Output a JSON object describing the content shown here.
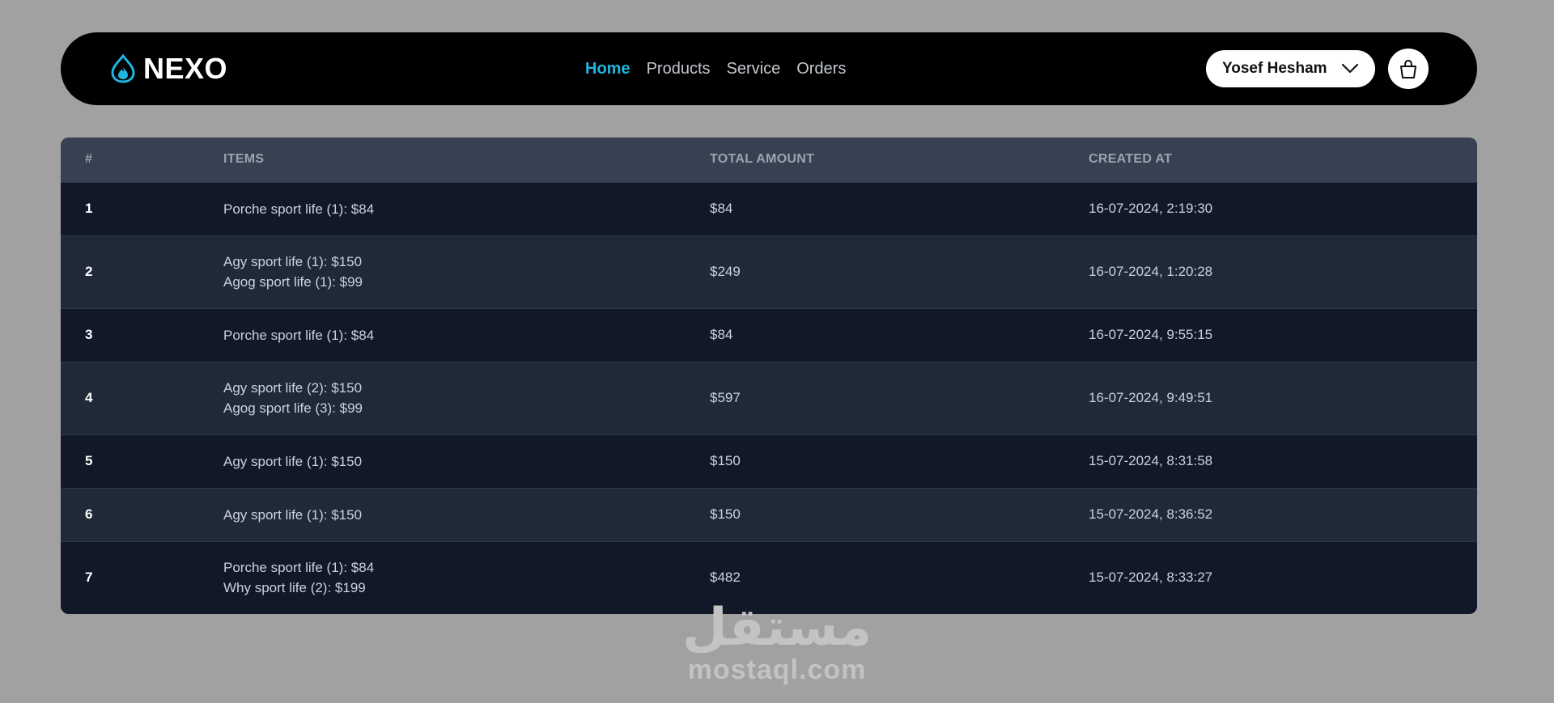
{
  "brand": {
    "name": "NEXO",
    "accent": "#1fb6e0"
  },
  "nav": {
    "links": [
      {
        "label": "Home",
        "active": true
      },
      {
        "label": "Products",
        "active": false
      },
      {
        "label": "Service",
        "active": false
      },
      {
        "label": "Orders",
        "active": false
      }
    ]
  },
  "user": {
    "name": "Yosef Hesham",
    "menu_icon": "chevron-down-icon"
  },
  "cart": {
    "icon": "shopping-bag-icon"
  },
  "orders_table": {
    "headers": [
      "#",
      "ITEMS",
      "TOTAL AMOUNT",
      "CREATED AT"
    ],
    "rows": [
      {
        "id": "1",
        "items": [
          "Porche sport life (1): $84"
        ],
        "total": "$84",
        "created": "16-07-2024, 2:19:30"
      },
      {
        "id": "2",
        "items": [
          "Agy sport life (1): $150",
          "Agog sport life (1): $99"
        ],
        "total": "$249",
        "created": "16-07-2024, 1:20:28"
      },
      {
        "id": "3",
        "items": [
          "Porche sport life (1): $84"
        ],
        "total": "$84",
        "created": "16-07-2024, 9:55:15"
      },
      {
        "id": "4",
        "items": [
          "Agy sport life (2): $150",
          "Agog sport life (3): $99"
        ],
        "total": "$597",
        "created": "16-07-2024, 9:49:51"
      },
      {
        "id": "5",
        "items": [
          "Agy sport life (1): $150"
        ],
        "total": "$150",
        "created": "15-07-2024, 8:31:58"
      },
      {
        "id": "6",
        "items": [
          "Agy sport life (1): $150"
        ],
        "total": "$150",
        "created": "15-07-2024, 8:36:52"
      },
      {
        "id": "7",
        "items": [
          "Porche sport life (1): $84",
          "Why sport life (2): $199"
        ],
        "total": "$482",
        "created": "15-07-2024, 8:33:27"
      }
    ]
  },
  "watermark": {
    "arabic": "مستقل",
    "latin": "mostaql.com"
  }
}
